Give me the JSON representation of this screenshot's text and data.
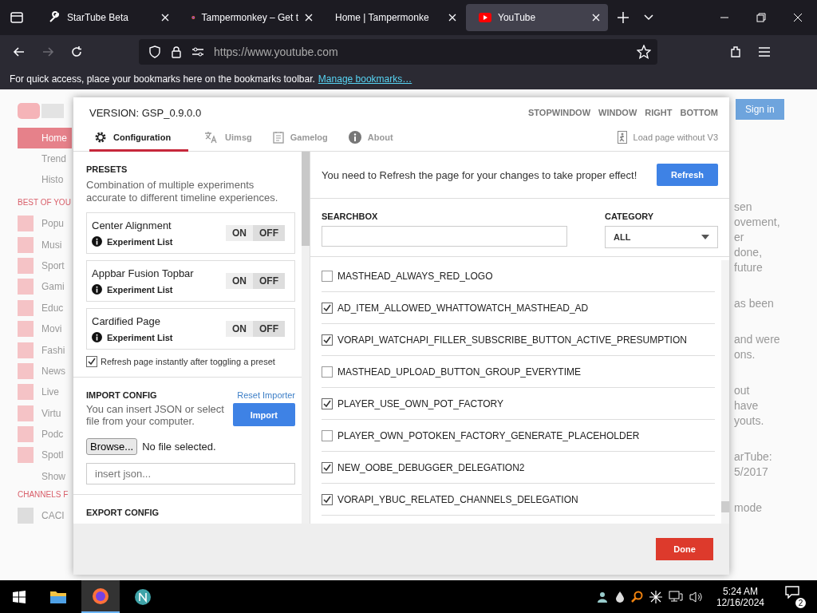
{
  "browser": {
    "tabs": [
      {
        "title": "StarTube Beta",
        "kind": "tool",
        "selected": false
      },
      {
        "title": "Tampermonkey – Get t",
        "kind": "firefox",
        "selected": false
      },
      {
        "title": "Home | Tampermonke",
        "kind": "none",
        "selected": false
      },
      {
        "title": "YouTube",
        "kind": "youtube",
        "selected": true
      }
    ],
    "address": "https://www.youtube.com",
    "bookmarks_message": "For quick access, place your bookmarks here on the bookmarks toolbar.",
    "bookmarks_link": "Manage bookmarks…"
  },
  "background_page": {
    "sign_in": "Sign in",
    "sidebar_top": [
      {
        "label": "Home",
        "selected": true
      },
      {
        "label": "Trend",
        "selected": false
      },
      {
        "label": "Histo",
        "selected": false
      }
    ],
    "section_1": "BEST OF YOU",
    "sidebar_best": [
      "Popu",
      "Musi",
      "Sport",
      "Gami",
      "Educ",
      "Movi",
      "Fashi",
      "News",
      "Live",
      "Virtu",
      "Podc",
      "Spotl"
    ],
    "show_more": "Show",
    "section_2": "CHANNELS F",
    "channel": "CACI",
    "text_fragments": [
      "sen",
      "ovement,",
      "er",
      "done,",
      "future",
      "as been",
      "and were",
      "ons.",
      "out",
      "have",
      "youts.",
      "arTube:",
      "5/2017",
      "mode"
    ]
  },
  "panel": {
    "version": "VERSION: GSP_0.9.0.0",
    "position_buttons": [
      "STOPWINDOW",
      "WINDOW",
      "RIGHT",
      "BOTTOM"
    ],
    "tabs": [
      {
        "label": "Configuration",
        "kind": "gear",
        "selected": true
      },
      {
        "label": "Uimsg",
        "kind": "translate",
        "selected": false
      },
      {
        "label": "Gamelog",
        "kind": "log",
        "selected": false
      },
      {
        "label": "About",
        "kind": "info",
        "selected": false
      }
    ],
    "load_without": "Load page without V3",
    "presets": {
      "heading": "PRESETS",
      "description": "Combination of multiple experiments accurate to different timeline experiences.",
      "items": [
        {
          "name": "Center Alignment",
          "link": "Experiment List",
          "on_label": "ON",
          "off_label": "OFF",
          "on": false
        },
        {
          "name": "Appbar Fusion Topbar",
          "link": "Experiment List",
          "on_label": "ON",
          "off_label": "OFF",
          "on": false
        },
        {
          "name": "Cardified Page",
          "link": "Experiment List",
          "on_label": "ON",
          "off_label": "OFF",
          "on": false
        }
      ],
      "refresh_option": {
        "label": "Refresh page instantly after toggling a preset",
        "checked": true
      }
    },
    "import": {
      "heading": "IMPORT CONFIG",
      "reset": "Reset Importer",
      "description": "You can insert JSON or select file from your computer.",
      "button": "Import",
      "browse": "Browse...",
      "file_status": "No file selected.",
      "placeholder": "insert json..."
    },
    "export_heading": "EXPORT CONFIG",
    "notice": "You need to Refresh the page for your changes to take proper effect!",
    "refresh_button": "Refresh",
    "search_label": "SEARCHBOX",
    "category_label": "CATEGORY",
    "category_value": "ALL",
    "experiments": [
      {
        "name": "MASTHEAD_ALWAYS_RED_LOGO",
        "checked": false
      },
      {
        "name": "AD_ITEM_ALLOWED_WHATTOWATCH_MASTHEAD_AD",
        "checked": true
      },
      {
        "name": "VORAPI_WATCHAPI_FILLER_SUBSCRIBE_BUTTON_ACTIVE_PRESUMPTION",
        "checked": true
      },
      {
        "name": "MASTHEAD_UPLOAD_BUTTON_GROUP_EVERYTIME",
        "checked": false
      },
      {
        "name": "PLAYER_USE_OWN_POT_FACTORY",
        "checked": true
      },
      {
        "name": "PLAYER_OWN_POTOKEN_FACTORY_GENERATE_PLACEHOLDER",
        "checked": false
      },
      {
        "name": "NEW_OOBE_DEBUGGER_DELEGATION2",
        "checked": true
      },
      {
        "name": "VORAPI_YBUC_RELATED_CHANNELS_DELEGATION",
        "checked": true
      }
    ],
    "done_button": "Done"
  },
  "taskbar": {
    "time": "5:24 AM",
    "date": "12/16/2024",
    "notifications": "2"
  }
}
